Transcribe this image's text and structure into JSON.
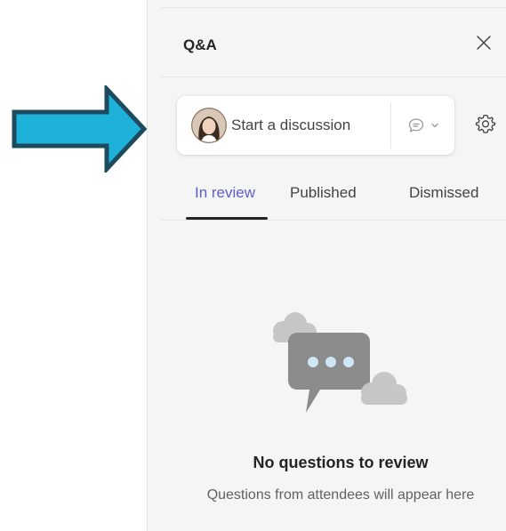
{
  "panel": {
    "title": "Q&A"
  },
  "compose": {
    "placeholder": "Start a discussion"
  },
  "tabs": [
    {
      "label": "In review",
      "active": true
    },
    {
      "label": "Published",
      "active": false
    },
    {
      "label": "Dismissed",
      "active": false
    }
  ],
  "empty_state": {
    "title": "No questions to review",
    "subtitle": "Questions from attendees will appear here"
  },
  "icons": {
    "close": "close-icon",
    "settings": "gear-icon",
    "discussion_type": "chat-bubble-icon",
    "dropdown": "chevron-down-icon",
    "avatar": "user-avatar"
  },
  "colors": {
    "accent": "#5b5fc7",
    "callout_arrow_fill": "#1eb2db",
    "callout_arrow_stroke": "#1d4a5c",
    "panel_background": "#f5f5f5",
    "illustration_bubble": "#8c8c8c",
    "illustration_dots": "#cfe6f7"
  }
}
